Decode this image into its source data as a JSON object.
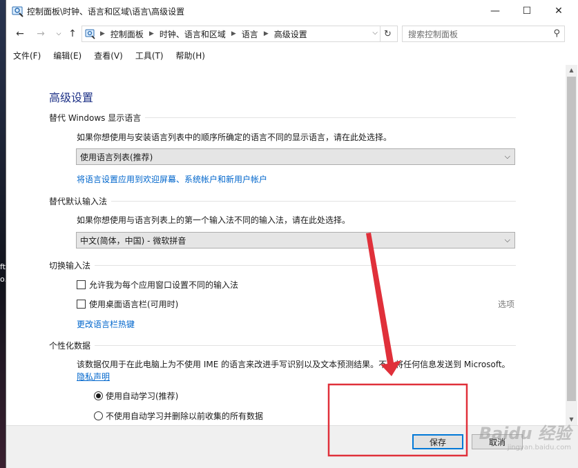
{
  "window": {
    "title": "控制面板\\时钟、语言和区域\\语言\\高级设置",
    "minimize_glyph": "—",
    "maximize_glyph": "☐",
    "close_glyph": "✕"
  },
  "address": {
    "breadcrumbs": [
      "控制面板",
      "时钟、语言和区域",
      "语言",
      "高级设置"
    ],
    "search_placeholder": "搜索控制面板"
  },
  "menu": [
    "文件(F)",
    "编辑(E)",
    "查看(V)",
    "工具(T)",
    "帮助(H)"
  ],
  "page": {
    "title": "高级设置",
    "display_language": {
      "heading": "替代 Windows 显示语言",
      "description": "如果你想使用与安装语言列表中的顺序所确定的语言不同的显示语言，请在此处选择。",
      "selected": "使用语言列表(推荐)",
      "apply_link": "将语言设置应用到欢迎屏幕、系统帐户和新用户帐户"
    },
    "default_input": {
      "heading": "替代默认输入法",
      "description": "如果你想使用与语言列表上的第一个输入法不同的输入法，请在此处选择。",
      "selected": "中文(简体，中国) - 微软拼音"
    },
    "switch_input": {
      "heading": "切换输入法",
      "checkbox1": "允许我为每个应用窗口设置不同的输入法",
      "checkbox2": "使用桌面语言栏(可用时)",
      "options": "选项",
      "hotkey_link": "更改语言栏热键"
    },
    "personalization": {
      "heading": "个性化数据",
      "description": "该数据仅用于在此电脑上为不使用 IME 的语言来改进手写识别以及文本预测结果。不会将任何信息发送到 Microsoft。",
      "privacy_link": "隐私声明",
      "radio1": "使用自动学习(推荐)",
      "radio2": "不使用自动学习并删除以前收集的所有数据"
    }
  },
  "buttons": {
    "save": "保存",
    "cancel": "取消"
  },
  "desktop": {
    "snippet1": "ft",
    "snippet2": "o."
  },
  "watermark": {
    "main": "Baidu 经验",
    "sub": "jingyan.baidu.com"
  },
  "colors": {
    "accent": "#0078d7",
    "link": "#0066cc",
    "title": "#1e3287",
    "annotation": "#e0303a"
  }
}
